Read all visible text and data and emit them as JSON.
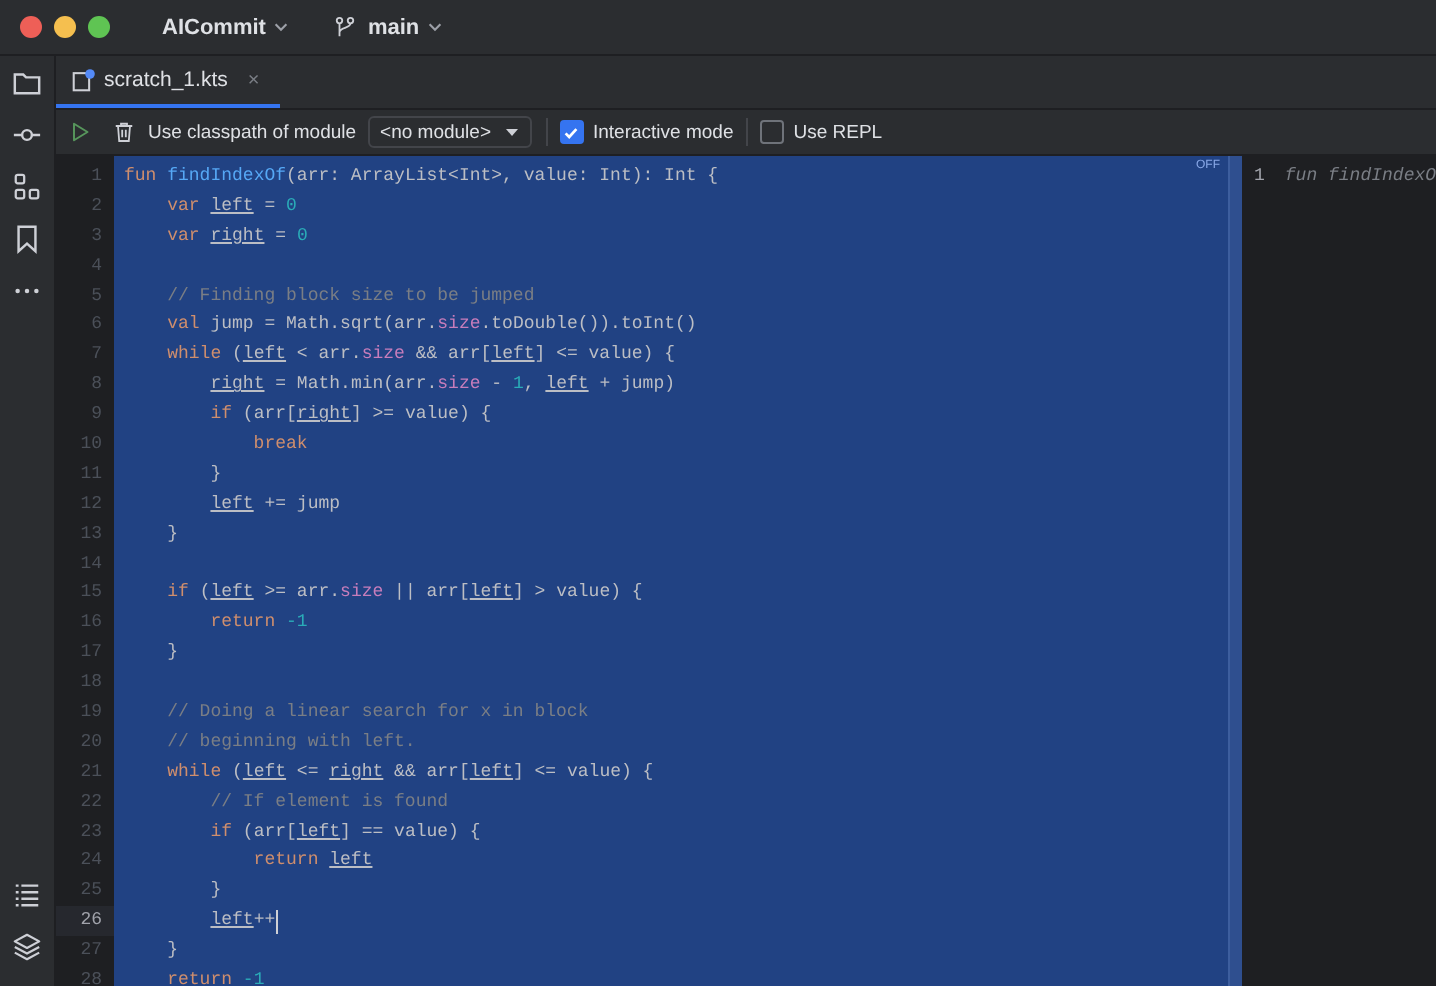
{
  "window": {
    "project": "AICommit",
    "branch": "main"
  },
  "tabs": [
    {
      "label": "scratch_1.kts",
      "selected": true,
      "close": "×"
    }
  ],
  "toolbar": {
    "classpath_label": "Use classpath of module",
    "module_dropdown": "<no module>",
    "options": [
      {
        "label": "Interactive mode",
        "checked": true
      },
      {
        "label": "Use REPL",
        "checked": false
      }
    ]
  },
  "editor": {
    "badge": "OFF",
    "lines": [
      {
        "number": "1",
        "current": false,
        "tokens": [
          {
            "text": "fun ",
            "kind": "keyword"
          },
          {
            "text": "findIndexOf",
            "kind": "function"
          },
          {
            "text": "(arr: ArrayList<Int>, value: Int): Int {",
            "kind": "plain"
          }
        ]
      },
      {
        "number": "2",
        "current": false,
        "tokens": [
          {
            "text": "    var ",
            "kind": "keyword"
          },
          {
            "text": "left",
            "kind": "variable"
          },
          {
            "text": " = ",
            "kind": "plain"
          },
          {
            "text": "0",
            "kind": "number"
          }
        ]
      },
      {
        "number": "3",
        "current": false,
        "tokens": [
          {
            "text": "    var ",
            "kind": "keyword"
          },
          {
            "text": "right",
            "kind": "variable"
          },
          {
            "text": " = ",
            "kind": "plain"
          },
          {
            "text": "0",
            "kind": "number"
          }
        ]
      },
      {
        "number": "4",
        "current": false
      },
      {
        "number": "5",
        "current": false,
        "tokens": [
          {
            "text": "    // Finding block size to be jumped",
            "kind": "comment"
          }
        ]
      },
      {
        "number": "6",
        "current": false,
        "tokens": [
          {
            "text": "    val ",
            "kind": "keyword"
          },
          {
            "text": "jump = Math.sqrt(arr.",
            "kind": "plain"
          },
          {
            "text": "size",
            "kind": "property"
          },
          {
            "text": ".toDouble()).toInt()",
            "kind": "plain"
          }
        ]
      },
      {
        "number": "7",
        "current": false,
        "tokens": [
          {
            "text": "    while ",
            "kind": "keyword"
          },
          {
            "text": "(",
            "kind": "plain"
          },
          {
            "text": "left",
            "kind": "variable"
          },
          {
            "text": " < arr.",
            "kind": "plain"
          },
          {
            "text": "size",
            "kind": "property"
          },
          {
            "text": " && arr[",
            "kind": "plain"
          },
          {
            "text": "left",
            "kind": "variable"
          },
          {
            "text": "] <= value) {",
            "kind": "plain"
          }
        ]
      },
      {
        "number": "8",
        "current": false,
        "tokens": [
          {
            "text": "        right",
            "kind": "variable"
          },
          {
            "text": " = Math.min(arr.",
            "kind": "plain"
          },
          {
            "text": "size",
            "kind": "property"
          },
          {
            "text": " - ",
            "kind": "plain"
          },
          {
            "text": "1",
            "kind": "number"
          },
          {
            "text": ", ",
            "kind": "plain"
          },
          {
            "text": "left",
            "kind": "variable"
          },
          {
            "text": " + jump)",
            "kind": "plain"
          }
        ]
      },
      {
        "number": "9",
        "current": false,
        "tokens": [
          {
            "text": "        if ",
            "kind": "keyword"
          },
          {
            "text": "(arr[",
            "kind": "plain"
          },
          {
            "text": "right",
            "kind": "variable"
          },
          {
            "text": "] >= value) {",
            "kind": "plain"
          }
        ]
      },
      {
        "number": "10",
        "current": false,
        "tokens": [
          {
            "text": "            break",
            "kind": "keyword"
          }
        ]
      },
      {
        "number": "11",
        "current": false,
        "tokens": [
          {
            "text": "        }",
            "kind": "plain"
          }
        ]
      },
      {
        "number": "12",
        "current": false,
        "tokens": [
          {
            "text": "        left",
            "kind": "variable"
          },
          {
            "text": " += jump",
            "kind": "plain"
          }
        ]
      },
      {
        "number": "13",
        "current": false,
        "tokens": [
          {
            "text": "    }",
            "kind": "plain"
          }
        ]
      },
      {
        "number": "14",
        "current": false
      },
      {
        "number": "15",
        "current": false,
        "tokens": [
          {
            "text": "    if ",
            "kind": "keyword"
          },
          {
            "text": "(",
            "kind": "plain"
          },
          {
            "text": "left",
            "kind": "variable"
          },
          {
            "text": " >= arr.",
            "kind": "plain"
          },
          {
            "text": "size",
            "kind": "property"
          },
          {
            "text": " || arr[",
            "kind": "plain"
          },
          {
            "text": "left",
            "kind": "variable"
          },
          {
            "text": "] > value) {",
            "kind": "plain"
          }
        ]
      },
      {
        "number": "16",
        "current": false,
        "tokens": [
          {
            "text": "        return ",
            "kind": "keyword"
          },
          {
            "text": "-1",
            "kind": "number"
          }
        ]
      },
      {
        "number": "17",
        "current": false,
        "tokens": [
          {
            "text": "    }",
            "kind": "plain"
          }
        ]
      },
      {
        "number": "18",
        "current": false
      },
      {
        "number": "19",
        "current": false,
        "tokens": [
          {
            "text": "    // Doing a linear search for x in block",
            "kind": "comment"
          }
        ]
      },
      {
        "number": "20",
        "current": false,
        "tokens": [
          {
            "text": "    // beginning with left.",
            "kind": "comment"
          }
        ]
      },
      {
        "number": "21",
        "current": false,
        "tokens": [
          {
            "text": "    while ",
            "kind": "keyword"
          },
          {
            "text": "(",
            "kind": "plain"
          },
          {
            "text": "left",
            "kind": "variable"
          },
          {
            "text": " <= ",
            "kind": "plain"
          },
          {
            "text": "right",
            "kind": "variable"
          },
          {
            "text": " && arr[",
            "kind": "plain"
          },
          {
            "text": "left",
            "kind": "variable"
          },
          {
            "text": "] <= value) {",
            "kind": "plain"
          }
        ]
      },
      {
        "number": "22",
        "current": false,
        "tokens": [
          {
            "text": "        // If element is found",
            "kind": "comment"
          }
        ]
      },
      {
        "number": "23",
        "current": false,
        "tokens": [
          {
            "text": "        if ",
            "kind": "keyword"
          },
          {
            "text": "(arr[",
            "kind": "plain"
          },
          {
            "text": "left",
            "kind": "variable"
          },
          {
            "text": "] == value) {",
            "kind": "plain"
          }
        ]
      },
      {
        "number": "24",
        "current": false,
        "tokens": [
          {
            "text": "            return ",
            "kind": "keyword"
          },
          {
            "text": "left",
            "kind": "variable"
          }
        ]
      },
      {
        "number": "25",
        "current": false,
        "tokens": [
          {
            "text": "        }",
            "kind": "plain"
          }
        ]
      },
      {
        "number": "26",
        "current": true,
        "tokens": [
          {
            "text": "        left",
            "kind": "variable"
          },
          {
            "text": "++",
            "kind": "plain"
          }
        ]
      },
      {
        "number": "27",
        "current": false,
        "tokens": [
          {
            "text": "    }",
            "kind": "plain"
          }
        ]
      },
      {
        "number": "28",
        "current": false,
        "tokens": [
          {
            "text": "    return ",
            "kind": "keyword"
          },
          {
            "text": "-1",
            "kind": "number"
          }
        ]
      }
    ]
  },
  "output": {
    "lines": [
      {
        "number": "1",
        "text": "fun findIndexO"
      }
    ]
  }
}
